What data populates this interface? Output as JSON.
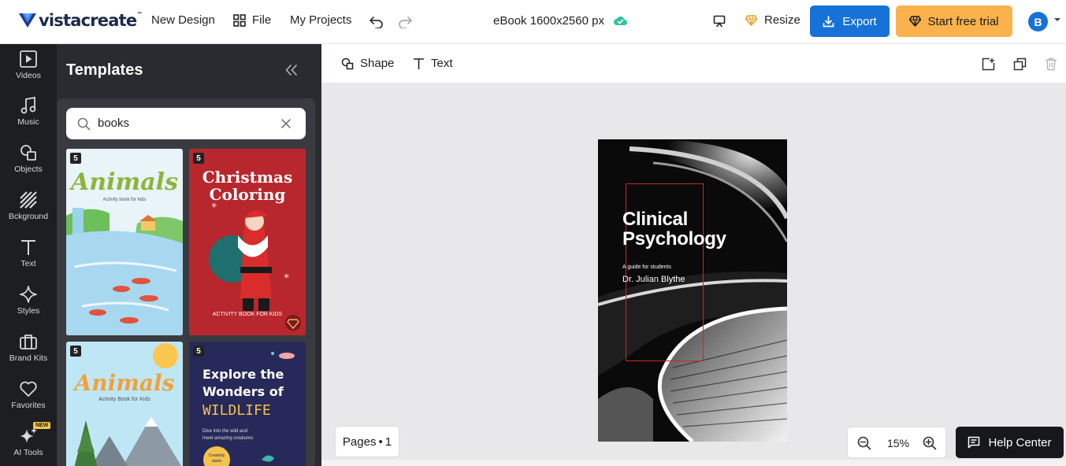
{
  "app": {
    "logo_text": "vistacreate",
    "logo_tm": "™"
  },
  "header": {
    "new_design": "New Design",
    "file": "File",
    "my_projects": "My Projects",
    "doc_title": "eBook 1600x2560 px",
    "resize": "Resize",
    "export": "Export",
    "start_trial": "Start free trial",
    "avatar_initial": "B"
  },
  "rail": {
    "items": [
      {
        "label": "Videos"
      },
      {
        "label": "Music"
      },
      {
        "label": "Objects"
      },
      {
        "label": "Bckground"
      },
      {
        "label": "Text"
      },
      {
        "label": "Styles"
      },
      {
        "label": "Brand Kits"
      },
      {
        "label": "Favorites"
      },
      {
        "label": "AI Tools"
      }
    ],
    "new_badge": "NEW"
  },
  "panel": {
    "title": "Templates",
    "search_value": "books",
    "cards": [
      {
        "count": "5",
        "title": "Animals",
        "subtitle": "Activity book for kids"
      },
      {
        "count": "5",
        "title_line1": "Christmas",
        "title_line2": "Coloring",
        "subtitle": "ACTIVITY BOOK FOR KIDS"
      },
      {
        "count": "5",
        "title": "Animals",
        "subtitle": "Activity Book for Kids"
      },
      {
        "count": "5",
        "title_line1": "Explore the",
        "title_line2": "Wonders of",
        "title_line3": "WILDLIFE",
        "subtitle_line1": "Dive into the wild and",
        "subtitle_line2": "meet amazing creatures",
        "circle_line1": "Creativity",
        "circle_line2": "starts"
      }
    ]
  },
  "toolbar": {
    "shape": "Shape",
    "text": "Text"
  },
  "canvas": {
    "title_line1": "Clinical",
    "title_line2": "Psychology",
    "subtitle": "A guide for students",
    "author": "Dr. Julian Blythe"
  },
  "footer": {
    "pages_label": "Pages",
    "pages_count": "1",
    "zoom": "15%",
    "help": "Help Center"
  },
  "colors": {
    "accent_blue": "#1672d6",
    "trial_orange": "#fbb24c",
    "sidebar_dark": "#1d1e22",
    "panel_dark": "#2a2b30"
  }
}
